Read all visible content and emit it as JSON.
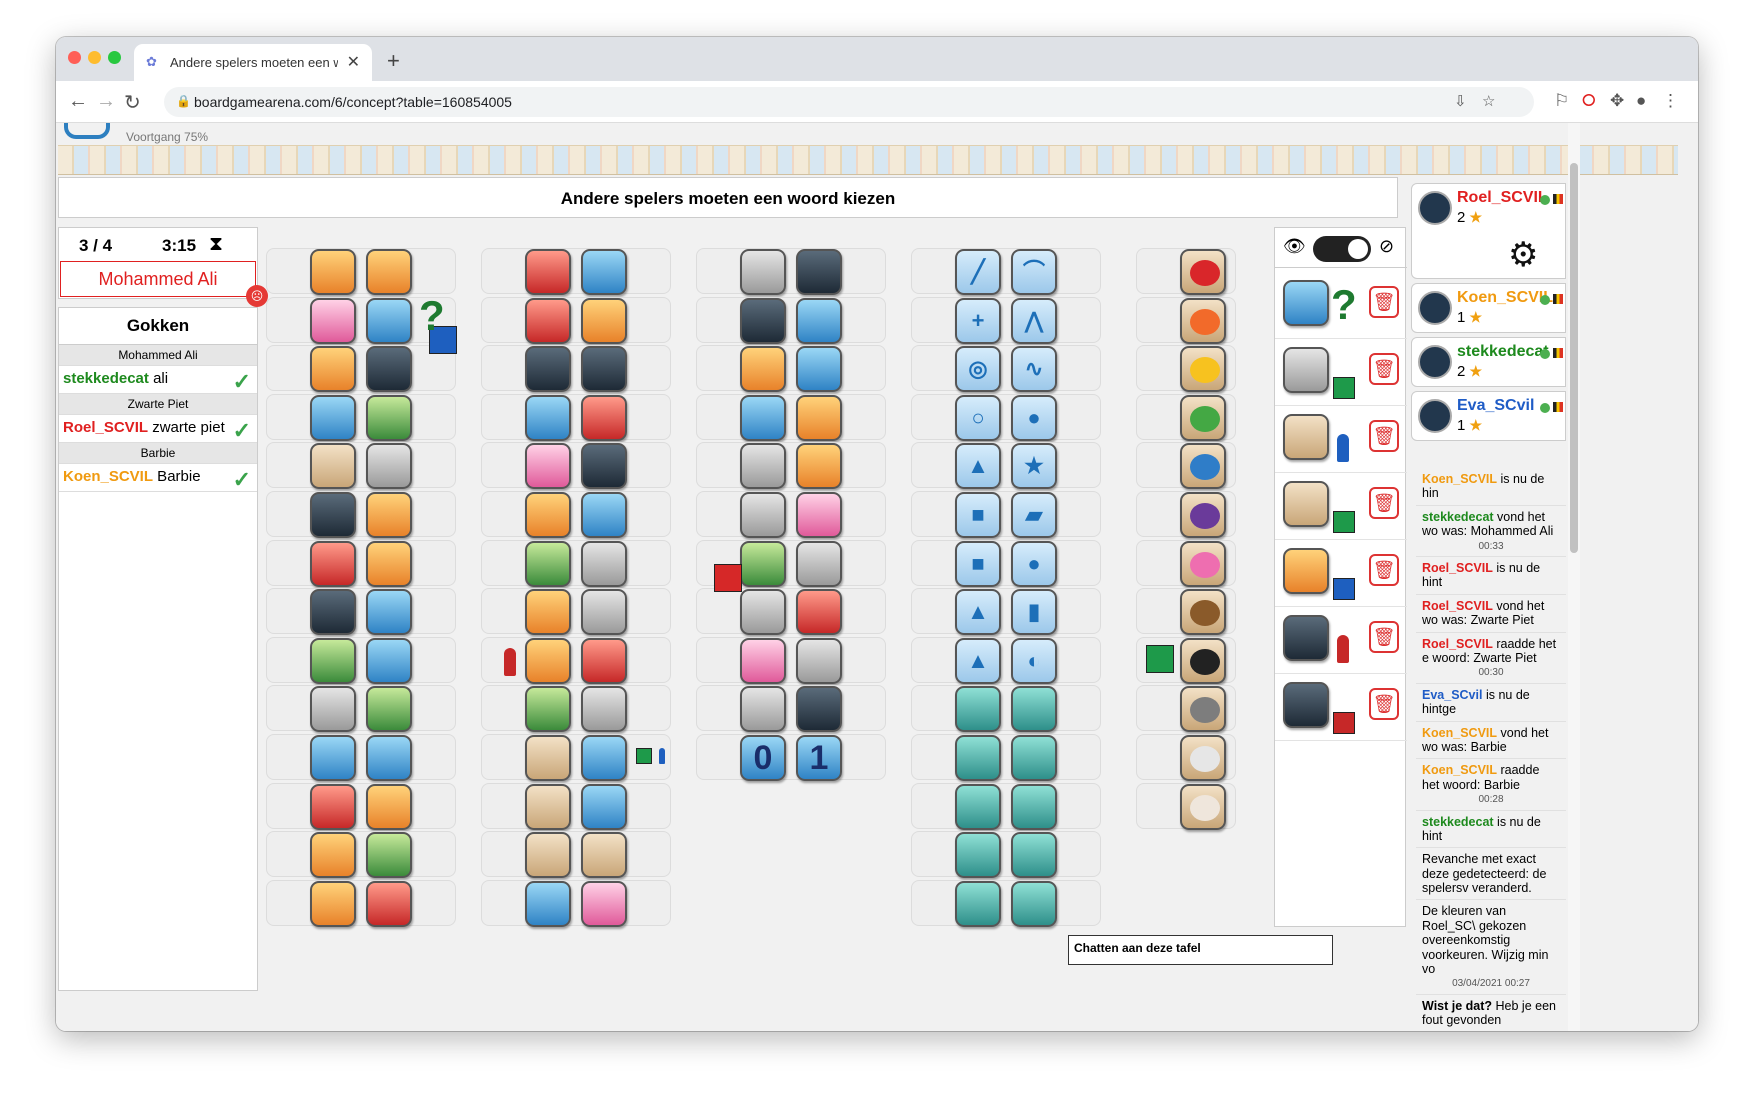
{
  "browser": {
    "tab_title": "Andere spelers moeten een wo",
    "url": "boardgamearena.com/6/concept?table=160854005",
    "new_tab": "+",
    "close": "✕"
  },
  "header": {
    "progress": "Voortgang 75%"
  },
  "title": "Andere spelers moeten een woord kiezen",
  "turn": {
    "count": "3 / 4",
    "time": "3:15",
    "current_word": "Mohammed Ali"
  },
  "guess_panel": {
    "title": "Gokken",
    "groups": [
      {
        "word": "Mohammed Ali",
        "entries": [
          {
            "player": "stekkedecat",
            "text": "ali",
            "color": "#1e8a1e"
          }
        ]
      },
      {
        "word": "Zwarte Piet",
        "entries": [
          {
            "player": "Roel_SCVIL",
            "text": "zwarte piet",
            "color": "#e02020"
          }
        ]
      },
      {
        "word": "Barbie",
        "entries": [
          {
            "player": "Koen_SCVIL",
            "text": "Barbie",
            "color": "#f09a10"
          }
        ]
      }
    ]
  },
  "board": {
    "columns": [
      {
        "rows": [
          [
            "g-orange",
            "g-orange"
          ],
          [
            "g-pink",
            "g-blue"
          ],
          [
            "g-orange",
            "g-dark"
          ],
          [
            "g-blue",
            "g-green"
          ],
          [
            "g-beige",
            "g-gray"
          ],
          [
            "g-dark",
            "g-orange"
          ],
          [
            "g-red",
            "g-orange"
          ],
          [
            "g-dark",
            "g-blue"
          ],
          [
            "g-green",
            "g-blue"
          ],
          [
            "g-gray",
            "g-green"
          ],
          [
            "g-blue",
            "g-blue"
          ],
          [
            "g-red",
            "g-orange"
          ],
          [
            "g-orange",
            "g-green"
          ],
          [
            "g-orange",
            "g-red"
          ]
        ]
      },
      {
        "rows": [
          [
            "g-red",
            "g-blue"
          ],
          [
            "g-red",
            "g-orange"
          ],
          [
            "g-dark",
            "g-dark"
          ],
          [
            "g-blue",
            "g-red"
          ],
          [
            "g-pink",
            "g-dark"
          ],
          [
            "g-orange",
            "g-blue"
          ],
          [
            "g-green",
            "g-gray"
          ],
          [
            "g-orange",
            "g-gray"
          ],
          [
            "g-orange",
            "g-red"
          ],
          [
            "g-green",
            "g-gray"
          ],
          [
            "g-beige",
            "g-blue"
          ],
          [
            "g-beige",
            "g-blue"
          ],
          [
            "g-beige",
            "g-beige"
          ],
          [
            "g-blue",
            "g-pink"
          ]
        ]
      },
      {
        "rows": [
          [
            "g-gray",
            "g-dark"
          ],
          [
            "g-dark",
            "g-blue"
          ],
          [
            "g-orange",
            "g-blue"
          ],
          [
            "g-blue",
            "g-orange"
          ],
          [
            "g-gray",
            "g-orange"
          ],
          [
            "g-gray",
            "g-pink"
          ],
          [
            "g-green",
            "g-gray"
          ],
          [
            "g-gray",
            "g-red"
          ],
          [
            "g-pink",
            "g-gray"
          ],
          [
            "g-gray",
            "g-dark"
          ],
          [
            "g-blue",
            "g-blue"
          ]
        ]
      },
      {
        "rows": [
          [
            "g-shape",
            "g-shape"
          ],
          [
            "g-shape",
            "g-shape"
          ],
          [
            "g-shape",
            "g-shape"
          ],
          [
            "g-shape",
            "g-shape"
          ],
          [
            "g-shape",
            "g-shape"
          ],
          [
            "g-shape",
            "g-shape"
          ],
          [
            "g-shape",
            "g-shape"
          ],
          [
            "g-shape",
            "g-shape"
          ],
          [
            "g-shape",
            "g-shape"
          ],
          [
            "g-teal",
            "g-teal"
          ],
          [
            "g-teal",
            "g-teal"
          ],
          [
            "g-teal",
            "g-teal"
          ],
          [
            "g-teal",
            "g-teal"
          ],
          [
            "g-teal",
            "g-teal"
          ]
        ]
      },
      {
        "rows": [
          [
            "#d9262a"
          ],
          [
            "#f26a2a"
          ],
          [
            "#f7c21f"
          ],
          [
            "#44a844"
          ],
          [
            "#2f7dc8"
          ],
          [
            "#6a3a9a"
          ],
          [
            "#ee6eb0"
          ],
          [
            "#8a5a2a"
          ],
          [
            "#222222"
          ],
          [
            "#7d7d7d"
          ],
          [
            "#e6e6e6"
          ],
          [
            "#efe6dc"
          ]
        ]
      }
    ],
    "number_labels": [
      "0",
      "1"
    ]
  },
  "toggle_icons": {
    "eye": "👁",
    "eye_off": "⊘"
  },
  "clue_rows": [
    {
      "icon": "g-blue",
      "marker": "question",
      "color": "#1e7a30"
    },
    {
      "icon": "g-gray",
      "marker": "square",
      "color": "#1e9a4a"
    },
    {
      "icon": "g-beige",
      "marker": "pawn",
      "color": "#1e5fbf"
    },
    {
      "icon": "g-beige",
      "marker": "square",
      "color": "#1e9a4a"
    },
    {
      "icon": "g-orange",
      "marker": "square",
      "color": "#1e5fbf"
    },
    {
      "icon": "g-dark",
      "marker": "pawn",
      "color": "#c62828"
    },
    {
      "icon": "g-dark",
      "marker": "square",
      "color": "#c62828"
    }
  ],
  "players": [
    {
      "name": "Roel_SCVIL",
      "score": "2",
      "color": "#e02020",
      "star": "★"
    },
    {
      "name": "Koen_SCVIL",
      "score": "1",
      "color": "#f09a10",
      "star": "★"
    },
    {
      "name": "stekkedecat",
      "score": "2",
      "color": "#1e8a1e",
      "star": "★"
    },
    {
      "name": "Eva_SCvil",
      "score": "1",
      "color": "#1f5cc6",
      "star": "★"
    }
  ],
  "chat": {
    "messages": [
      {
        "user": "Koen_SCVIL",
        "color": "#f09a10",
        "text": " is nu de hin"
      },
      {
        "user": "stekkedecat",
        "color": "#1e8a1e",
        "text": " vond het wo was: Mohammed Ali",
        "time": "00:33"
      },
      {
        "user": "Roel_SCVIL",
        "color": "#e02020",
        "text": " is nu de hint"
      },
      {
        "user": "Roel_SCVIL",
        "color": "#e02020",
        "text": " vond het wo was: Zwarte Piet"
      },
      {
        "user": "Roel_SCVIL",
        "color": "#e02020",
        "text": " raadde het e woord: Zwarte Piet",
        "time": "00:30"
      },
      {
        "user": "Eva_SCvil",
        "color": "#1f5cc6",
        "text": " is nu de hintge"
      },
      {
        "user": "Koen_SCVIL",
        "color": "#f09a10",
        "text": " vond het wo was: Barbie"
      },
      {
        "user": "Koen_SCVIL",
        "color": "#f09a10",
        "text": " raadde het woord: Barbie",
        "time": "00:28"
      },
      {
        "user": "stekkedecat",
        "color": "#1e8a1e",
        "text": " is nu de hint"
      },
      {
        "user": "",
        "color": "#000000",
        "text": "Revanche met exact deze gedetecteerd: de spelersv veranderd."
      },
      {
        "user": "",
        "color": "#000000",
        "text": "De kleuren van Roel_SC\\ gekozen overeenkomstig voorkeuren. Wijzig min vo",
        "time": "03/04/2021 00:27"
      },
      {
        "user": "Wist je dat?",
        "color": "#000000",
        "text": " Heb je een fout gevonden"
      }
    ],
    "input_placeholder": "Chatten aan deze tafel"
  }
}
